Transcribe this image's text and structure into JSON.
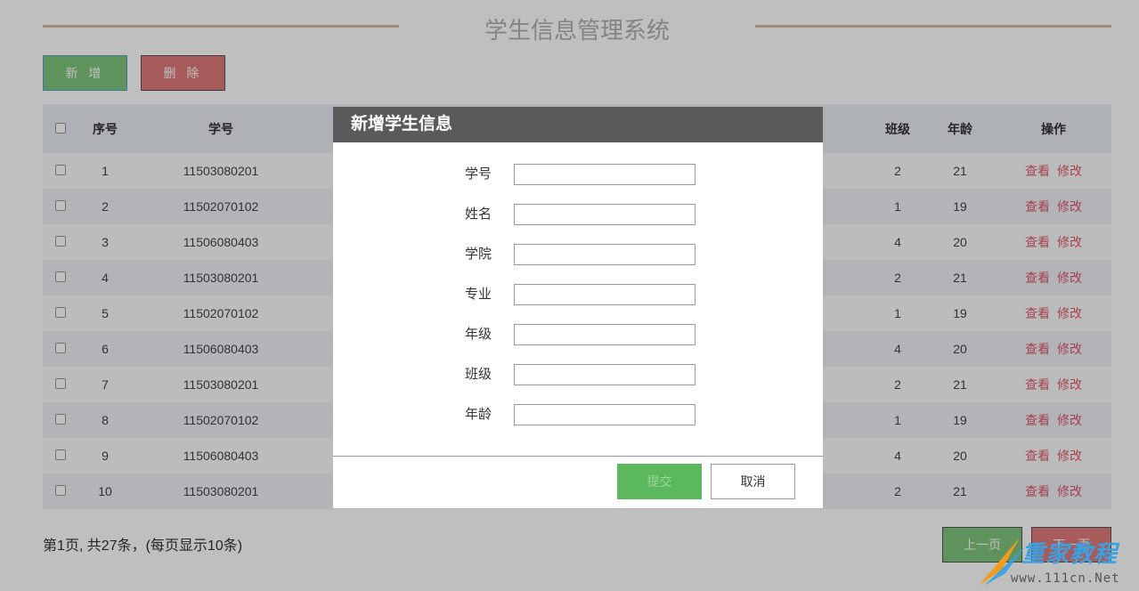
{
  "page": {
    "title": "学生信息管理系统",
    "add_label": "新 增",
    "delete_label": "删 除"
  },
  "table": {
    "headers": [
      "序号",
      "学号",
      "班级",
      "年龄",
      "操作"
    ],
    "view_label": "查看",
    "edit_label": "修改",
    "rows": [
      {
        "index": "1",
        "id": "11503080201",
        "class": "2",
        "age": "21"
      },
      {
        "index": "2",
        "id": "11502070102",
        "class": "1",
        "age": "19"
      },
      {
        "index": "3",
        "id": "11506080403",
        "class": "4",
        "age": "20"
      },
      {
        "index": "4",
        "id": "11503080201",
        "class": "2",
        "age": "21"
      },
      {
        "index": "5",
        "id": "11502070102",
        "class": "1",
        "age": "19"
      },
      {
        "index": "6",
        "id": "11506080403",
        "class": "4",
        "age": "20"
      },
      {
        "index": "7",
        "id": "11503080201",
        "class": "2",
        "age": "21"
      },
      {
        "index": "8",
        "id": "11502070102",
        "class": "1",
        "age": "19"
      },
      {
        "index": "9",
        "id": "11506080403",
        "class": "4",
        "age": "20"
      },
      {
        "index": "10",
        "id": "11503080201",
        "class": "2",
        "age": "21"
      }
    ]
  },
  "pager": {
    "info": "第1页, 共27条，(每页显示10条)",
    "prev_label": "上一页",
    "next_label": "下一页"
  },
  "modal": {
    "title": "新增学生信息",
    "fields": [
      {
        "label": "学号",
        "value": ""
      },
      {
        "label": "姓名",
        "value": ""
      },
      {
        "label": "学院",
        "value": ""
      },
      {
        "label": "专业",
        "value": ""
      },
      {
        "label": "年级",
        "value": ""
      },
      {
        "label": "班级",
        "value": ""
      },
      {
        "label": "年龄",
        "value": ""
      }
    ],
    "submit_label": "提交",
    "cancel_label": "取消"
  },
  "watermark": {
    "brand": "重家教程",
    "url": "www.111cn.Net"
  },
  "colors": {
    "add_green": "#7ec57e",
    "delete_red": "#e07a7a",
    "link_red": "#e0566a",
    "modal_header": "#5a5a5a",
    "title_line": "#d4b79a"
  }
}
